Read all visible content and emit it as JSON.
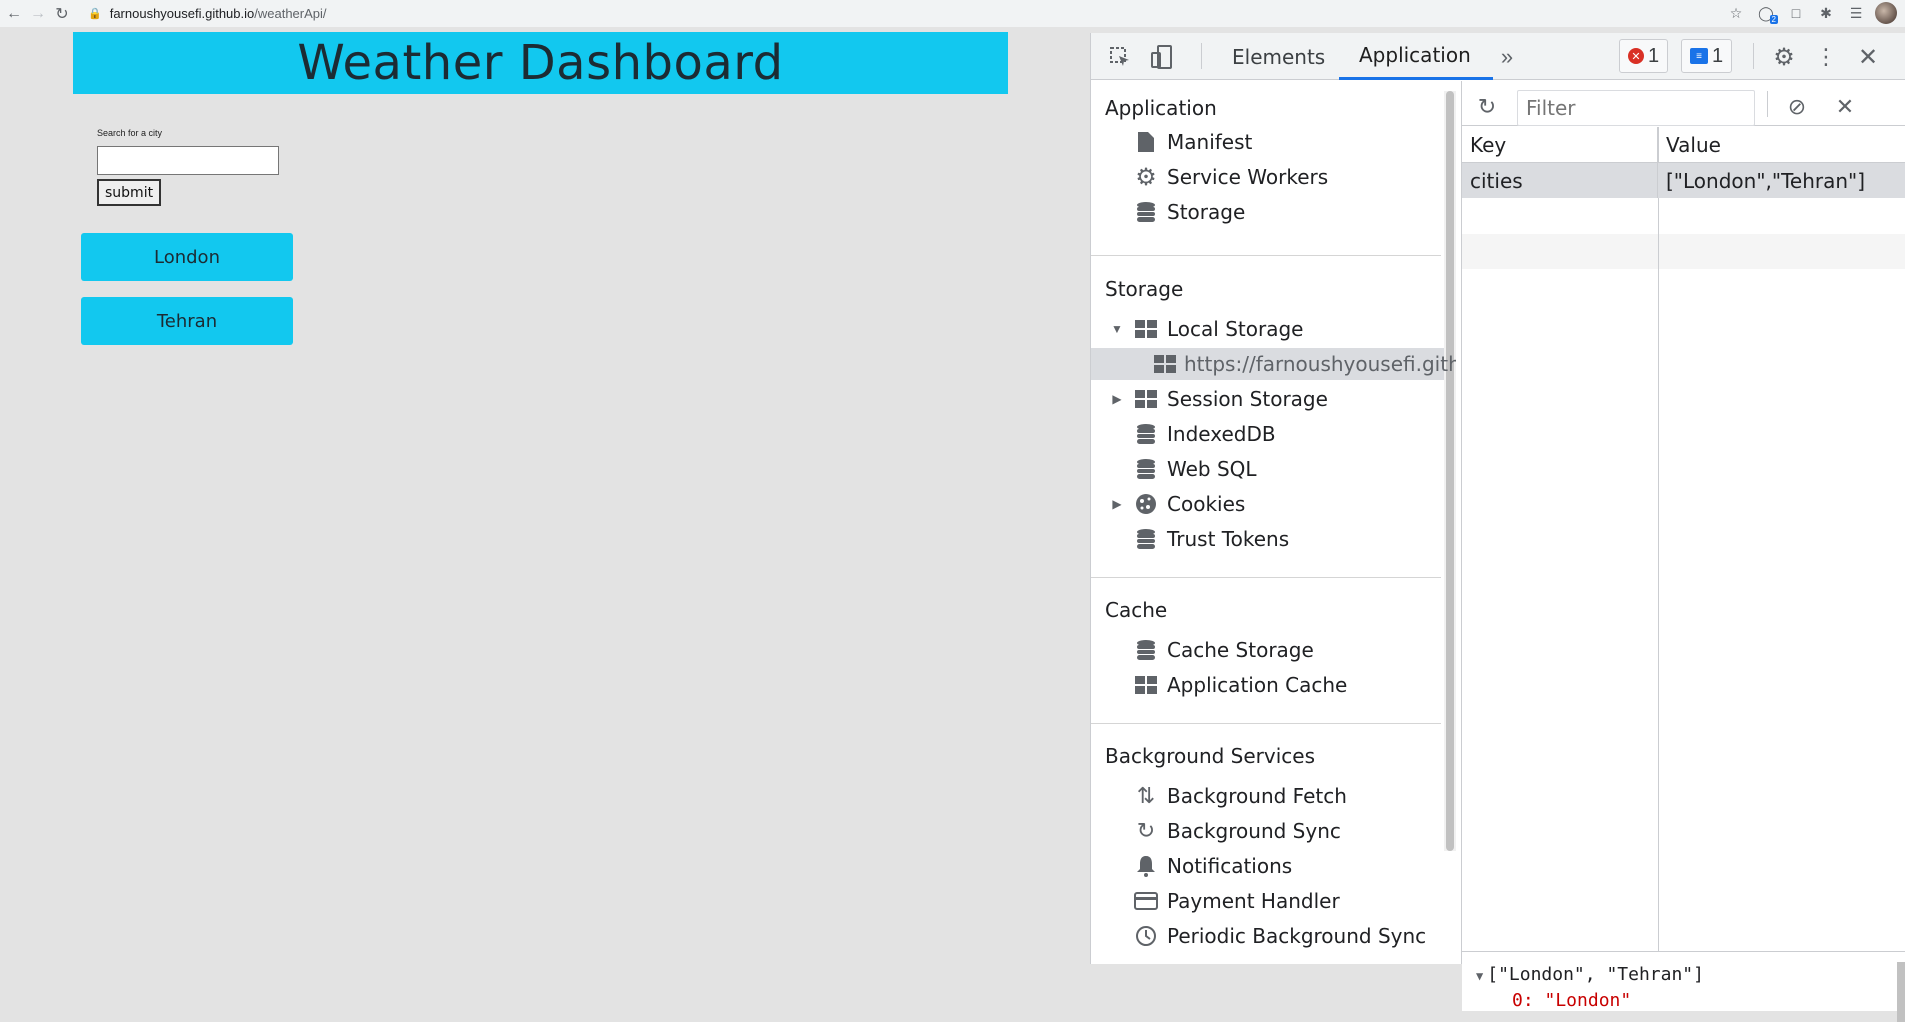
{
  "browser": {
    "url_host": "farnoushyousefi.github.io",
    "url_path": "/weatherApi/",
    "extension_badge": "2"
  },
  "app": {
    "title": "Weather Dashboard",
    "search_label": "Search for a city",
    "search_value": "",
    "submit_label": "submit",
    "cities": [
      "London",
      "Tehran"
    ]
  },
  "devtools": {
    "tabs": [
      "Elements",
      "Application"
    ],
    "active_tab": "Application",
    "errors_count": "1",
    "messages_count": "1",
    "sidebar": {
      "application_title": "Application",
      "application_items": [
        "Manifest",
        "Service Workers",
        "Storage"
      ],
      "storage_title": "Storage",
      "storage_items": [
        "Local Storage",
        "https://farnoushyousefi.github.io",
        "Session Storage",
        "IndexedDB",
        "Web SQL",
        "Cookies",
        "Trust Tokens"
      ],
      "cache_title": "Cache",
      "cache_items": [
        "Cache Storage",
        "Application Cache"
      ],
      "background_title": "Background Services",
      "background_items": [
        "Background Fetch",
        "Background Sync",
        "Notifications",
        "Payment Handler",
        "Periodic Background Sync"
      ]
    },
    "storage_view": {
      "filter_placeholder": "Filter",
      "columns": [
        "Key",
        "Value"
      ],
      "rows": [
        {
          "key": "cities",
          "value": "[\"London\",\"Tehran\"]"
        }
      ],
      "preview_line": "[\"London\", \"Tehran\"]",
      "preview_sub": "0: \"London\""
    }
  }
}
